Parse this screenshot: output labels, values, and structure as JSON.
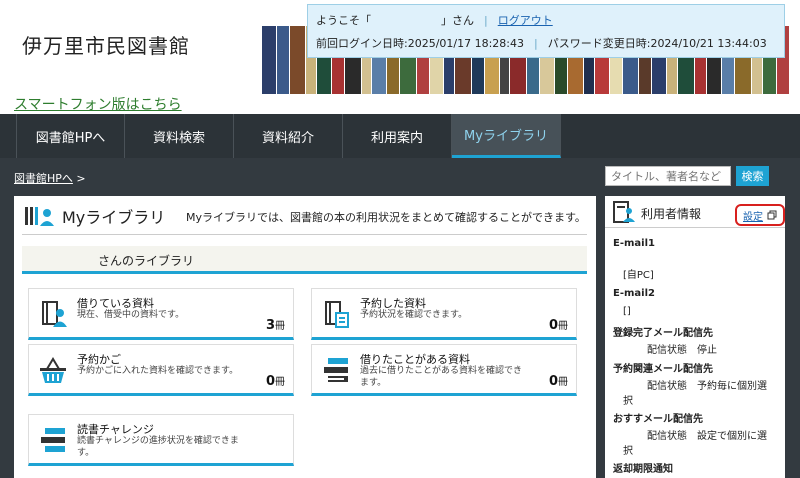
{
  "header": {
    "site_title": "伊万里市民図書館",
    "smartphone_link": "スマートフォン版はこちら",
    "login_box": {
      "welcome_prefix": "ようこそ「",
      "welcome_suffix": "」さん",
      "logout": "ログアウト",
      "last_login": "前回ログイン日時:2025/01/17 18:28:43",
      "pw_change": "パスワード変更日時:2024/10/21 13:44:03"
    }
  },
  "nav": {
    "items": [
      "図書館HPへ",
      "資料検索",
      "資料紹介",
      "利用案内",
      "Myライブラリ"
    ],
    "active_index": 4
  },
  "breadcrumb": {
    "link": "図書館HPへ",
    "sep": ">"
  },
  "search": {
    "placeholder": "タイトル、著者名など",
    "button": "検索"
  },
  "main": {
    "title": "Myライブラリ",
    "description": "Myライブラリでは、図書館の本の利用状況をまとめて確認することができます。",
    "library_bar": "さんのライブラリ",
    "cards": [
      {
        "title": "借りている資料",
        "desc": "現在、借受中の資料です。",
        "count": "3",
        "unit": "冊"
      },
      {
        "title": "予約した資料",
        "desc": "予約状況を確認できます。",
        "count": "0",
        "unit": "冊"
      },
      {
        "title": "予約かご",
        "desc": "予約かごに入れた資料を確認できます。",
        "count": "0",
        "unit": "冊"
      },
      {
        "title": "借りたことがある資料",
        "desc": "過去に借りたことがある資料を確認できます。",
        "count": "0",
        "unit": "冊"
      },
      {
        "title": "読書チャレンジ",
        "desc": "読書チャレンジの進捗状況を確認できます。"
      }
    ]
  },
  "side": {
    "title": "利用者情報",
    "settings": "設定",
    "lines": [
      "E-mail1",
      "[自PC]",
      "E-mail2",
      "[]",
      "登録完了メール配信先",
      "配信状態　停止",
      "予約関連メール配信先",
      "配信状態　予約毎に個別選",
      "択",
      "おすすメール配信先",
      "配信状態　設定で個別に選",
      "択",
      "返却期限通知"
    ]
  },
  "colors": {
    "accent": "#1ea3d3",
    "nav_bg": "#2c3338",
    "highlight": "#d8201e"
  }
}
